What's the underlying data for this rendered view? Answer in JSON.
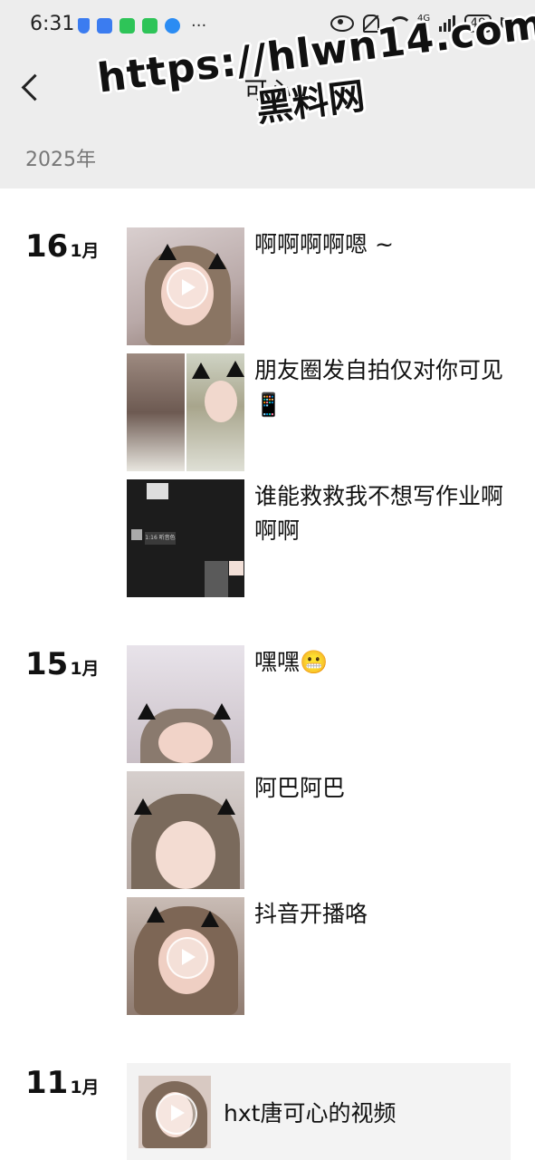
{
  "status_bar": {
    "time": "6:31",
    "more": "···",
    "network": "4G",
    "battery": "49"
  },
  "nav": {
    "title": "可心",
    "back_icon": "chevron-left-icon"
  },
  "year": "2025年",
  "watermark": {
    "url": "https://hlwn14.com",
    "name": "黑料网"
  },
  "days": [
    {
      "day": "16",
      "month": "1月",
      "posts": [
        {
          "text": "啊啊啊啊嗯 ~",
          "media": "video"
        },
        {
          "text": "朋友圈发自拍仅对你可见📱",
          "media": "two-photos"
        },
        {
          "text": "谁能救救我不想写作业啊啊啊",
          "media": "screenshot"
        }
      ]
    },
    {
      "day": "15",
      "month": "1月",
      "posts": [
        {
          "text": "嘿嘿😬",
          "media": "photo"
        },
        {
          "text": "阿巴阿巴",
          "media": "photo"
        },
        {
          "text": "抖音开播咯",
          "media": "video"
        }
      ]
    },
    {
      "day": "11",
      "month": "1月",
      "posts": [
        {
          "text": "hxt唐可心的视频",
          "media": "shared-video"
        }
      ]
    }
  ],
  "screenshot_thumb": {
    "badge": "1:16 听音色"
  },
  "colors": {
    "header_bg": "#ededed",
    "card_bg": "#f3f3f3",
    "year_text": "#777777"
  }
}
